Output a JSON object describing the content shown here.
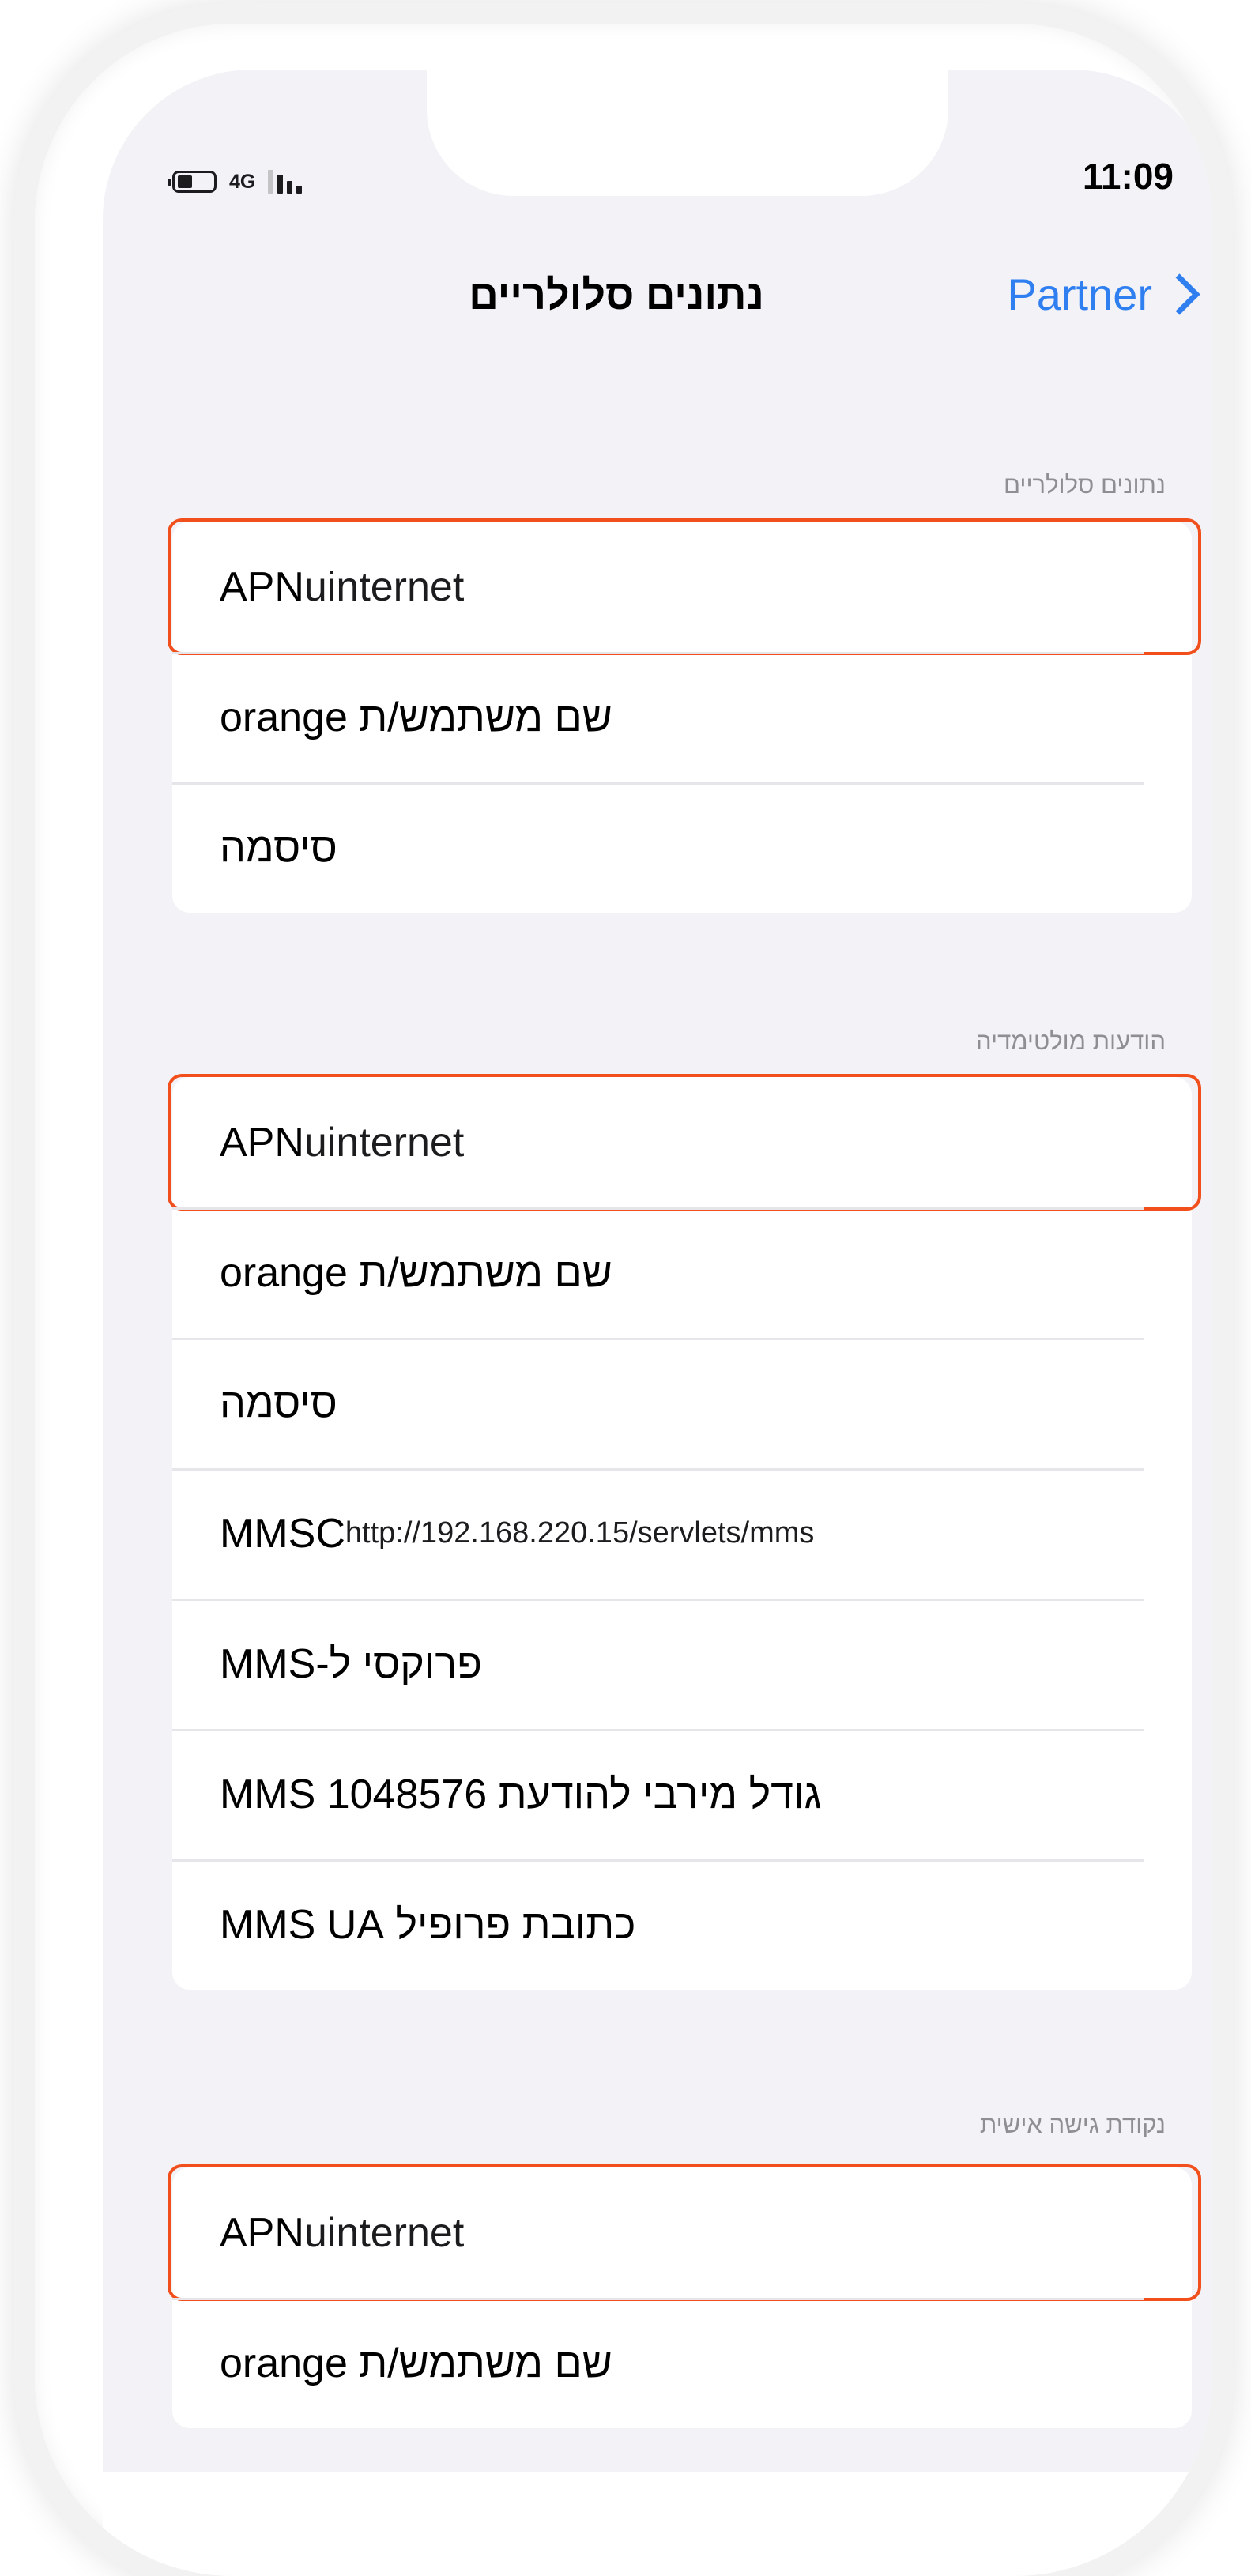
{
  "status_bar": {
    "network_type": "4G",
    "time": "11:09"
  },
  "nav": {
    "title": "נתונים סלולריים",
    "back_label": "Partner"
  },
  "sections": [
    {
      "header": "נתונים סלולריים",
      "rows": [
        {
          "label": "APN",
          "value": "uinternet",
          "highlighted": true
        },
        {
          "label": "שם משתמש/ת orange"
        },
        {
          "label": "סיסמה"
        }
      ]
    },
    {
      "header": "הודעות מולטימדיה",
      "rows": [
        {
          "label": "APN",
          "value": "uinternet",
          "highlighted": true
        },
        {
          "label": "שם משתמש/ת orange"
        },
        {
          "label": "סיסמה"
        },
        {
          "label": "MMSC",
          "value": "http://192.168.220.15/servlets/mms"
        },
        {
          "label": "פרוקסי ל-MMS"
        },
        {
          "label": "גודל מירבי להודעת MMS 1048576"
        },
        {
          "label": "כתובת פרופיל MMS UA"
        }
      ]
    },
    {
      "header": "נקודת גישה אישית",
      "rows": [
        {
          "label": "APN",
          "value": "uinternet",
          "highlighted": true
        },
        {
          "label": "שם משתמש/ת orange"
        }
      ]
    }
  ],
  "colors": {
    "accent": "#2f7ff0",
    "highlight": "#f1501d",
    "background": "#f2f2f7"
  }
}
